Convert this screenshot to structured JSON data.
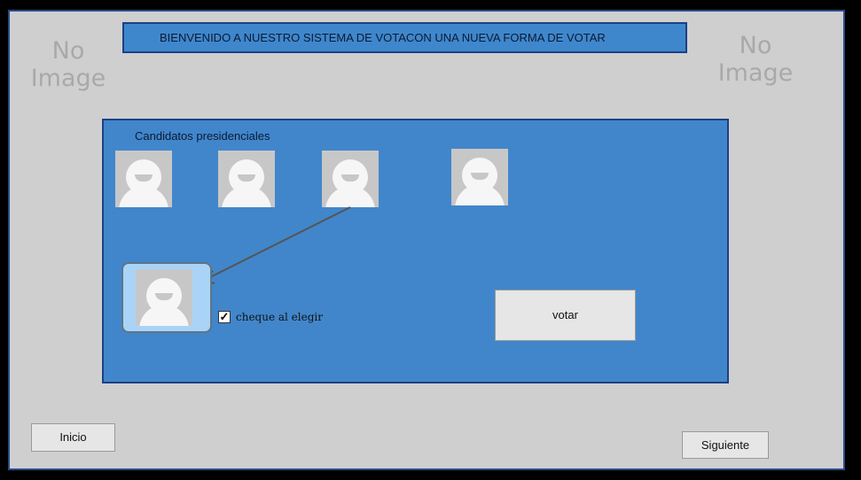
{
  "header": {
    "banner_text": "BIENVENIDO A NUESTRO SISTEMA DE VOTACON UNA NUEVA FORMA DE VOTAR"
  },
  "placeholders": {
    "left": "No Image",
    "right": "No Image"
  },
  "panel": {
    "title": "Candidatos presidenciales",
    "checkbox_label": "cheque al elegir",
    "checkbox_checked": true,
    "vote_label": "votar"
  },
  "nav": {
    "start_label": "Inicio",
    "next_label": "Siguiente"
  },
  "colors": {
    "frame": "#cfcfcf",
    "panel": "#4186cb",
    "selected": "#a9d4f7"
  }
}
